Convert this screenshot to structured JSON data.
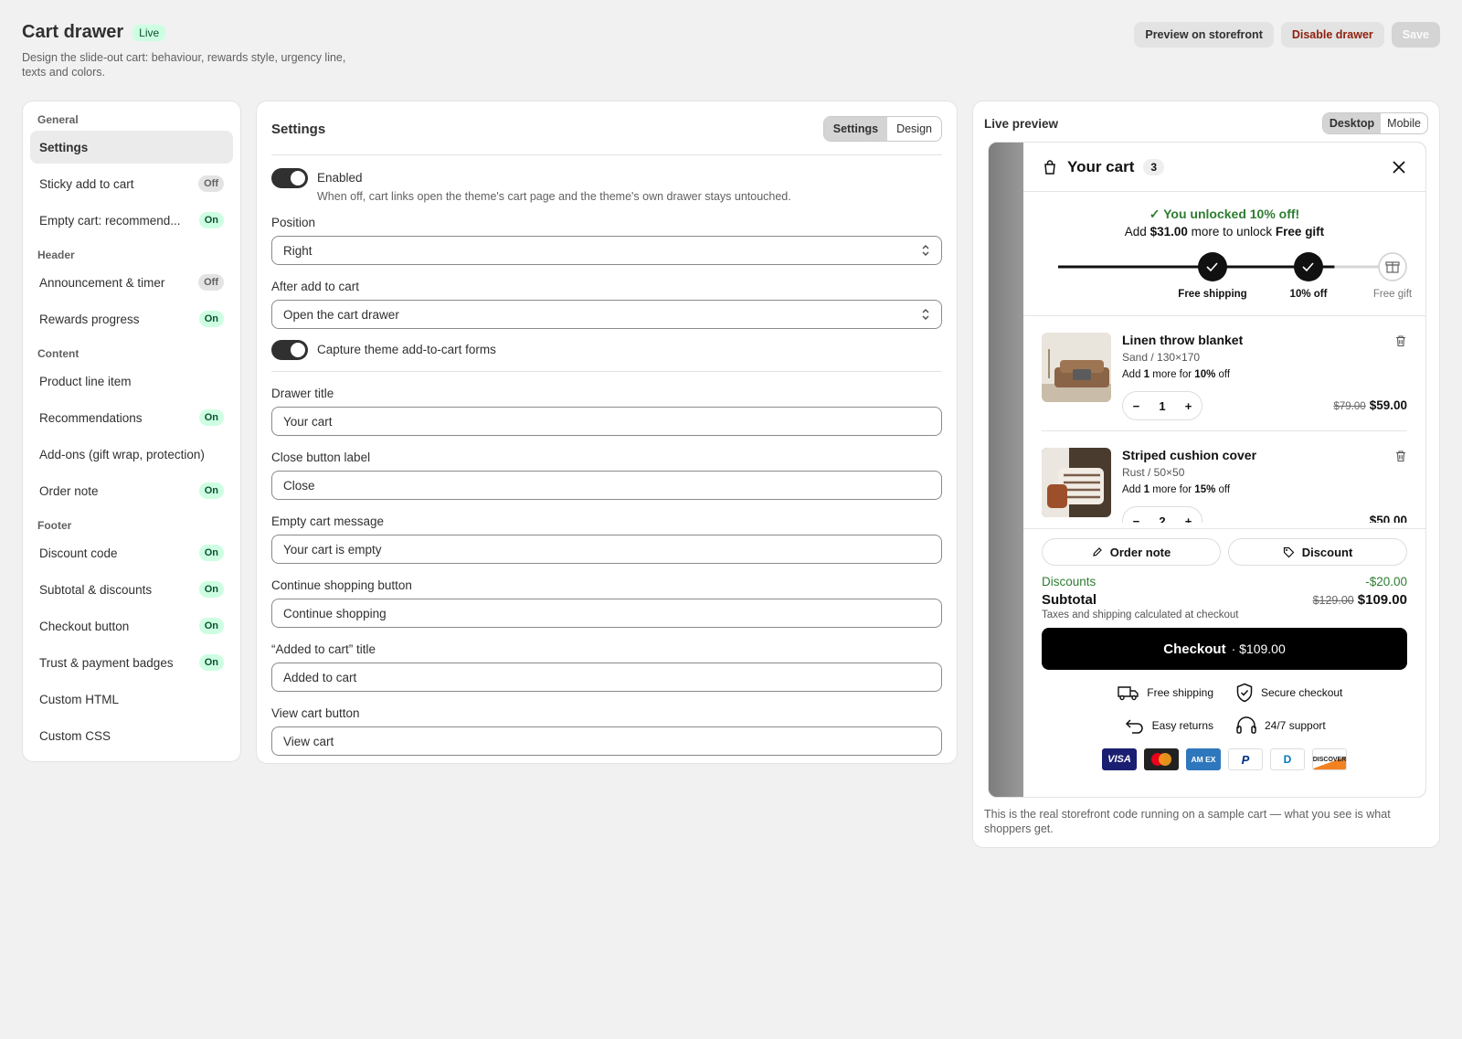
{
  "header": {
    "title": "Cart drawer",
    "status": "Live",
    "subtitle": "Design the slide-out cart: behaviour, rewards style, urgency line, texts and colors.",
    "buttons": {
      "preview": "Preview on storefront",
      "disable": "Disable drawer",
      "save": "Save"
    }
  },
  "sidebar": {
    "sections": [
      {
        "title": "General",
        "items": [
          {
            "label": "Settings",
            "active": true
          }
        ]
      },
      {
        "title": "",
        "items": [
          {
            "label": "Sticky add to cart",
            "state": "Off"
          },
          {
            "label": "Empty cart: recommend...",
            "state": "On"
          }
        ]
      },
      {
        "title": "Header",
        "items": [
          {
            "label": "Announcement & timer",
            "state": "Off"
          },
          {
            "label": "Rewards progress",
            "state": "On"
          }
        ]
      },
      {
        "title": "Content",
        "items": [
          {
            "label": "Product line item"
          },
          {
            "label": "Recommendations",
            "state": "On"
          },
          {
            "label": "Add-ons (gift wrap, protection)"
          },
          {
            "label": "Order note",
            "state": "On"
          }
        ]
      },
      {
        "title": "Footer",
        "items": [
          {
            "label": "Discount code",
            "state": "On"
          },
          {
            "label": "Subtotal & discounts",
            "state": "On"
          },
          {
            "label": "Checkout button",
            "state": "On"
          },
          {
            "label": "Trust & payment badges",
            "state": "On"
          },
          {
            "label": "Custom HTML"
          },
          {
            "label": "Custom CSS"
          }
        ]
      }
    ]
  },
  "main": {
    "title": "Settings",
    "tabs": [
      "Settings",
      "Design"
    ],
    "enabled": {
      "label": "Enabled",
      "help": "When off, cart links open the theme's cart page and the theme's own drawer stays untouched."
    },
    "position": {
      "label": "Position",
      "value": "Right"
    },
    "after_add": {
      "label": "After add to cart",
      "value": "Open the cart drawer"
    },
    "capture": {
      "label": "Capture theme add-to-cart forms"
    },
    "fields": [
      {
        "label": "Drawer title",
        "value": "Your cart"
      },
      {
        "label": "Close button label",
        "value": "Close"
      },
      {
        "label": "Empty cart message",
        "value": "Your cart is empty"
      },
      {
        "label": "Continue shopping button",
        "value": "Continue shopping"
      },
      {
        "label": "“Added to cart” title",
        "value": "Added to cart"
      },
      {
        "label": "View cart button",
        "value": "View cart"
      }
    ]
  },
  "preview": {
    "title": "Live preview",
    "tabs": [
      "Desktop",
      "Mobile"
    ],
    "note": "This is the real storefront code running on a sample cart — what you see is what shoppers get.",
    "drawer": {
      "title": "Your cart",
      "count": "3",
      "rewards": {
        "unlocked": "✓ You unlocked 10% off!",
        "line_pre": "Add ",
        "line_amount": "$31.00",
        "line_mid": " more to unlock ",
        "line_target": "Free gift",
        "milestones": [
          {
            "label": "Free shipping",
            "done": true
          },
          {
            "label": "10% off",
            "done": true
          },
          {
            "label": "Free gift",
            "done": false
          }
        ],
        "progress": 0.8
      },
      "items": [
        {
          "name": "Linen throw blanket",
          "variant": "Sand / 130×170",
          "hint_pre": "Add ",
          "hint_qty": "1",
          "hint_mid": " more for ",
          "hint_pct": "10%",
          "hint_post": " off",
          "qty": "1",
          "compare": "$79.00",
          "price": "$59.00"
        },
        {
          "name": "Striped cushion cover",
          "variant": "Rust / 50×50",
          "hint_pre": "Add ",
          "hint_qty": "1",
          "hint_mid": " more for ",
          "hint_pct": "15%",
          "hint_post": " off",
          "qty": "2",
          "compare": "",
          "price": "$50.00"
        }
      ],
      "order_note": "Order note",
      "discount": "Discount",
      "discounts_label": "Discounts",
      "discounts_value": "-$20.00",
      "subtotal_label": "Subtotal",
      "subtotal_compare": "$129.00",
      "subtotal_value": "$109.00",
      "tax_note": "Taxes and shipping calculated at checkout",
      "checkout_label": "Checkout",
      "checkout_price": "· $109.00",
      "trust": [
        "Free shipping",
        "Secure checkout",
        "Easy returns",
        "24/7 support"
      ],
      "payments": [
        "VISA",
        "",
        "AM EX",
        "P",
        "D",
        "DISCOVER"
      ]
    }
  }
}
